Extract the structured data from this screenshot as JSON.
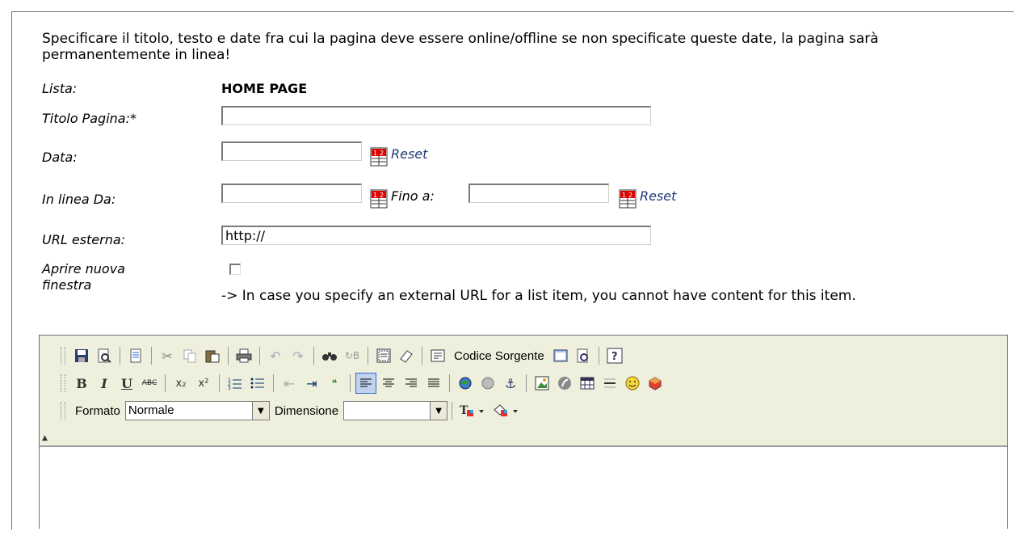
{
  "intro": "Specificare il titolo, testo e date fra cui la pagina deve essere online/offline se non specificate queste date, la pagina sarà permanentemente in linea!",
  "fields": {
    "lista_label": "Lista:",
    "lista_value": "HOME PAGE",
    "titolo_label": "Titolo Pagina:*",
    "titolo_value": "",
    "data_label": "Data:",
    "data_value": "",
    "reset_label": "Reset",
    "inlinea_label": "In linea Da:",
    "inlinea_value": "",
    "fino_label": "Fino a:",
    "fino_value": "",
    "reset2_label": "Reset",
    "url_label": "URL esterna:",
    "url_value": "http://",
    "nuova_label_1": "Aprire nuova",
    "nuova_label_2": "finestra",
    "nuova_checked": false,
    "note": "-> In case you specify an external URL for a list item, you cannot have content for this item."
  },
  "editor": {
    "source_label": "Codice Sorgente",
    "format_label": "Formato",
    "format_value": "Normale",
    "size_label": "Dimensione",
    "size_value": "",
    "row1_icons": [
      "save-icon",
      "preview-icon",
      "templates-icon",
      "cut-icon",
      "copy-icon",
      "paste-icon",
      "print-icon",
      "undo-icon",
      "redo-icon",
      "find-icon",
      "replace-icon",
      "select-all-icon",
      "remove-format-icon",
      "source-icon",
      "maximize-icon",
      "show-blocks-icon",
      "help-icon"
    ],
    "row2_icons": [
      "bold-icon",
      "italic-icon",
      "underline-icon",
      "strikethrough-icon",
      "subscript-icon",
      "superscript-icon",
      "numbered-list-icon",
      "bulleted-list-icon",
      "outdent-icon",
      "indent-icon",
      "blockquote-icon",
      "align-left-icon",
      "align-center-icon",
      "align-right-icon",
      "align-justify-icon",
      "link-icon",
      "unlink-icon",
      "anchor-icon",
      "image-icon",
      "flash-icon",
      "table-icon",
      "horizontal-rule-icon",
      "smiley-icon",
      "special-char-icon"
    ],
    "active_button": "align-left-icon"
  }
}
